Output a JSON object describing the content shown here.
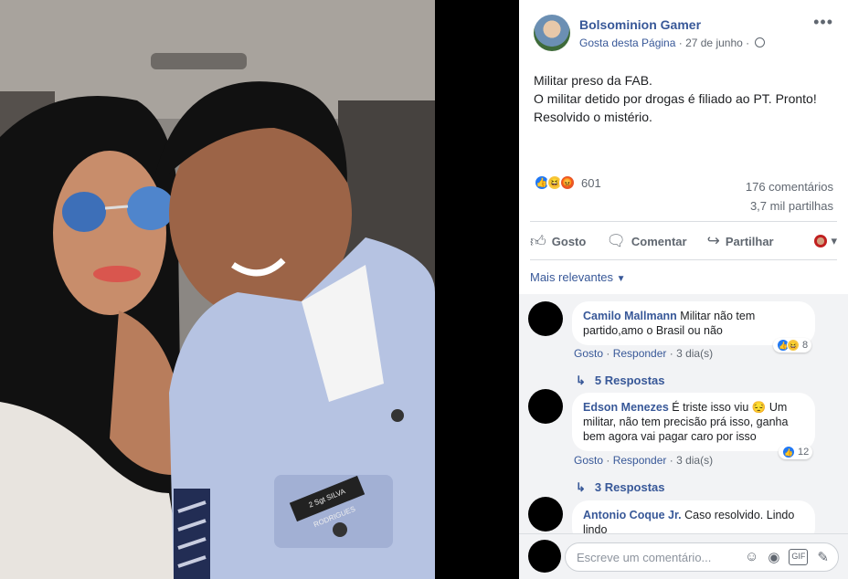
{
  "post": {
    "page_name": "Bolsominion Gamer",
    "like_page": "Gosta desta Página",
    "separator": " · ",
    "date": "27 de junho",
    "separator2": " · ",
    "text_line1": "Militar preso da FAB.",
    "text_line2": "O militar detido por drogas é filiado ao PT. Pronto!",
    "text_line3": "Resolvido o mistério.",
    "reaction_count": "601",
    "comments_count": "176 comentários",
    "shares_count": "3,7 mil partilhas"
  },
  "actions": {
    "like": "Gosto",
    "comment": "Comentar",
    "share": "Partilhar"
  },
  "sort_label": "Mais relevantes",
  "comments": [
    {
      "author": "Camilo Mallmann",
      "text": "Militar não tem partido,amo o Brasil ou não",
      "like": "Gosto",
      "reply": "Responder",
      "time": "3 dia(s)",
      "reactions": "8",
      "replies": "5 Respostas"
    },
    {
      "author": "Edson Menezes",
      "text": "É triste isso viu 😔 Um militar, não tem precisão prá isso, ganha bem agora vai pagar caro por isso",
      "like": "Gosto",
      "reply": "Responder",
      "time": "3 dia(s)",
      "reactions": "12",
      "replies": "3 Respostas"
    },
    {
      "author": "Antonio Coque Jr.",
      "text": "Caso resolvido. Lindo lindo"
    }
  ],
  "write_placeholder": "Escreve um comentário...",
  "photo": {
    "badge_text": "2 Sgt SILVA RODRIGUES"
  },
  "icons": {
    "like": "thumbs-up-icon",
    "comment": "comment-bubble-icon",
    "share": "share-arrow-icon",
    "more": "more-dots-icon",
    "globe": "globe-icon"
  },
  "colors": {
    "link": "#385898",
    "like_blue": "#2078f4",
    "meta_gray": "#606770"
  }
}
